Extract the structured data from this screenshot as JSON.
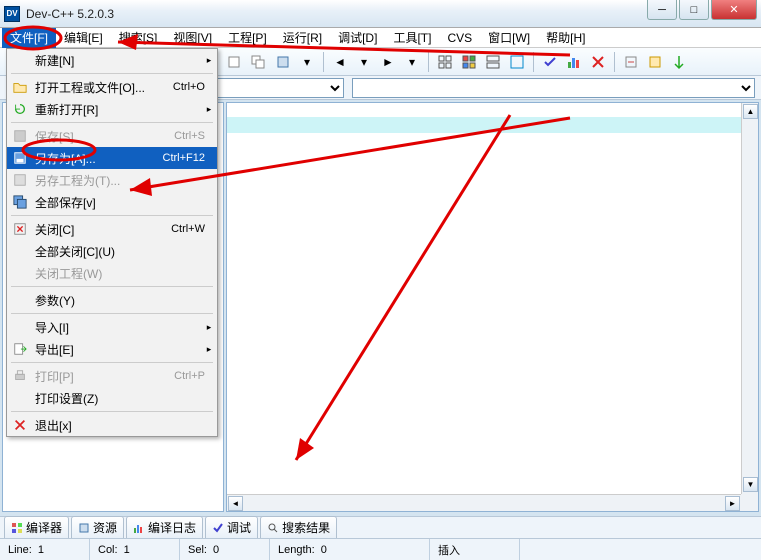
{
  "window": {
    "title": "Dev-C++ 5.2.0.3"
  },
  "menubar": [
    {
      "k": "file",
      "label": "文件[F]",
      "active": true
    },
    {
      "k": "edit",
      "label": "编辑[E]"
    },
    {
      "k": "search",
      "label": "搜索[S]"
    },
    {
      "k": "view",
      "label": "视图[V]"
    },
    {
      "k": "project",
      "label": "工程[P]"
    },
    {
      "k": "run",
      "label": "运行[R]"
    },
    {
      "k": "debug",
      "label": "调试[D]"
    },
    {
      "k": "tools",
      "label": "工具[T]"
    },
    {
      "k": "cvs",
      "label": "CVS"
    },
    {
      "k": "window",
      "label": "窗口[W]"
    },
    {
      "k": "help",
      "label": "帮助[H]"
    }
  ],
  "file_menu": {
    "new": {
      "label": "新建[N]",
      "submenu": true
    },
    "open": {
      "label": "打开工程或文件[O]...",
      "short": "Ctrl+O"
    },
    "reopen": {
      "label": "重新打开[R]",
      "submenu": true
    },
    "save": {
      "label": "保存[S]",
      "short": "Ctrl+S",
      "disabled": true
    },
    "saveas": {
      "label": "另存为[A]...",
      "short": "Ctrl+F12",
      "highlight": true
    },
    "saveprj": {
      "label": "另存工程为(T)...",
      "disabled": true
    },
    "saveall": {
      "label": "全部保存[v]"
    },
    "close": {
      "label": "关闭[C]",
      "short": "Ctrl+W"
    },
    "closeall": {
      "label": "全部关闭[C](U)"
    },
    "closeprj": {
      "label": "关闭工程(W)",
      "disabled": true
    },
    "params": {
      "label": "参数(Y)"
    },
    "import": {
      "label": "导入[I]",
      "submenu": true
    },
    "export": {
      "label": "导出[E]",
      "submenu": true
    },
    "print": {
      "label": "打印[P]",
      "short": "Ctrl+P",
      "disabled": true
    },
    "printset": {
      "label": "打印设置(Z)"
    },
    "exit": {
      "label": "退出[x]"
    }
  },
  "bottom_tabs": {
    "compiler": "编译器",
    "resources": "资源",
    "compilelog": "编译日志",
    "debug": "调试",
    "searchres": "搜索结果"
  },
  "statusbar": {
    "line_lbl": "Line:",
    "line_val": "1",
    "col_lbl": "Col:",
    "col_val": "1",
    "sel_lbl": "Sel:",
    "sel_val": "0",
    "len_lbl": "Length:",
    "len_val": "0",
    "ins": "插入"
  }
}
